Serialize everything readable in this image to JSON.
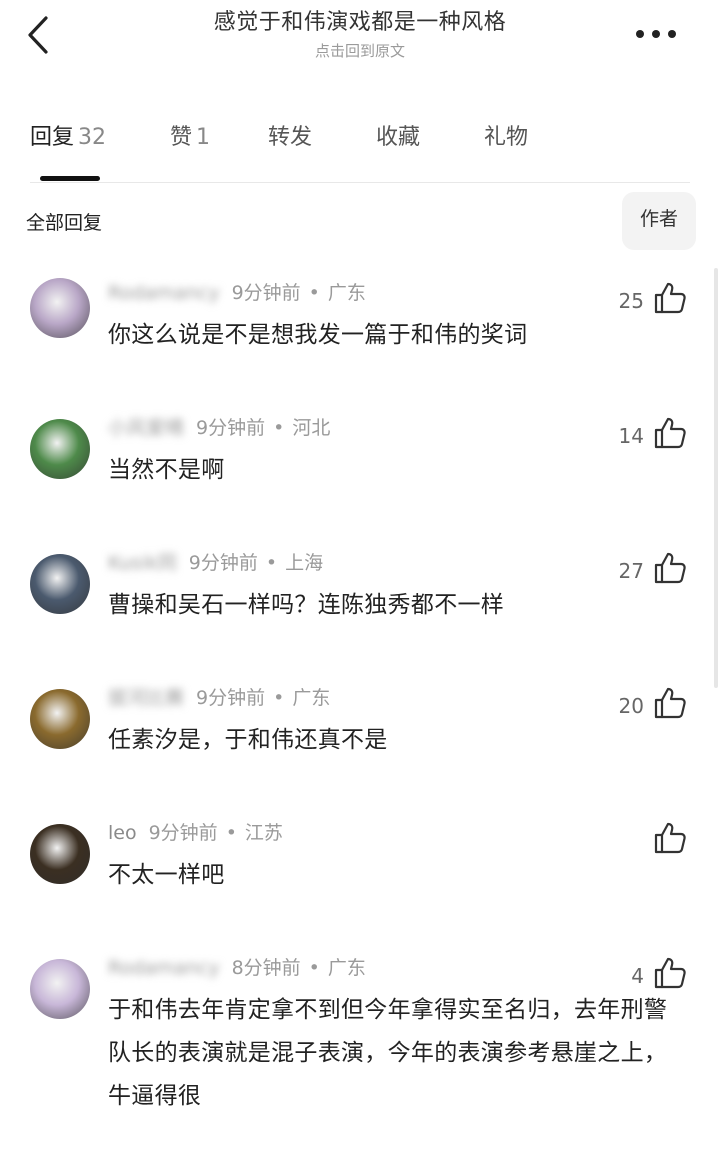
{
  "header": {
    "title": "感觉于和伟演戏都是一种风格",
    "subtitle": "点击回到原文",
    "back_icon": "chevron-left-icon",
    "more_icon": "more-horizontal-icon"
  },
  "tabs": [
    {
      "label": "回复",
      "count": "32",
      "active": true
    },
    {
      "label": "赞",
      "count": "1",
      "active": false
    },
    {
      "label": "转发",
      "count": "",
      "active": false
    },
    {
      "label": "收藏",
      "count": "",
      "active": false
    },
    {
      "label": "礼物",
      "count": "",
      "active": false
    }
  ],
  "section": {
    "title": "全部回复",
    "author_filter": "作者"
  },
  "comments": [
    {
      "username": "Rodamancy",
      "username_blurred": true,
      "time": "9分钟前",
      "location": "广东",
      "text": "你这么说是不是想我发一篇于和伟的奖词",
      "likes": "25",
      "avatar_color": "#b9a7c7"
    },
    {
      "username": "小风爱晴",
      "username_blurred": true,
      "time": "9分钟前",
      "location": "河北",
      "text": "当然不是啊",
      "likes": "14",
      "avatar_color": "#4e8a4a"
    },
    {
      "username": "Kusik同",
      "username_blurred": true,
      "time": "9分钟前",
      "location": "上海",
      "text": "曹操和吴石一样吗？连陈独秀都不一样",
      "likes": "27",
      "avatar_color": "#4b5a6e"
    },
    {
      "username": "拔河比赛",
      "username_blurred": true,
      "time": "9分钟前",
      "location": "广东",
      "text": "任素汐是，于和伟还真不是",
      "likes": "20",
      "avatar_color": "#8a6a2e"
    },
    {
      "username": "leo",
      "username_blurred": false,
      "time": "9分钟前",
      "location": "江苏",
      "text": "不太一样吧",
      "likes": "",
      "avatar_color": "#3b2f22"
    },
    {
      "username": "Rodamancy",
      "username_blurred": true,
      "time": "8分钟前",
      "location": "广东",
      "text": "于和伟去年肯定拿不到但今年拿得实至名归，去年刑警队长的表演就是混子表演，今年的表演参考悬崖之上，牛逼得很",
      "likes": "4",
      "avatar_color": "#c8b7d8"
    }
  ]
}
